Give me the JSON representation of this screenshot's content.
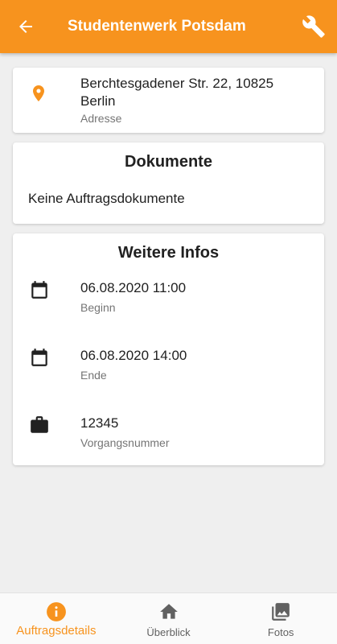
{
  "appbar": {
    "title": "Studentenwerk Potsdam",
    "back_icon": "arrow-back-icon",
    "tool_icon": "wrench-icon",
    "color": "#f7931e"
  },
  "address": {
    "value": "Berchtesgadener Str. 22, 10825 Berlin",
    "label": "Adresse",
    "icon": "location-pin-icon"
  },
  "documents": {
    "title": "Dokumente",
    "text": "Keine Auftragsdokumente"
  },
  "info": {
    "title": "Weitere Infos",
    "items": [
      {
        "value": "06.08.2020 11:00",
        "label": "Beginn",
        "icon": "calendar-icon"
      },
      {
        "value": "06.08.2020 14:00",
        "label": "Ende",
        "icon": "calendar-icon"
      },
      {
        "value": "12345",
        "label": "Vorgangsnummer",
        "icon": "briefcase-icon"
      }
    ]
  },
  "bottomnav": {
    "items": [
      {
        "label": "Auftragsdetails",
        "icon": "info-icon",
        "active": true
      },
      {
        "label": "Überblick",
        "icon": "home-icon",
        "active": false
      },
      {
        "label": "Fotos",
        "icon": "photos-icon",
        "active": false
      }
    ]
  }
}
